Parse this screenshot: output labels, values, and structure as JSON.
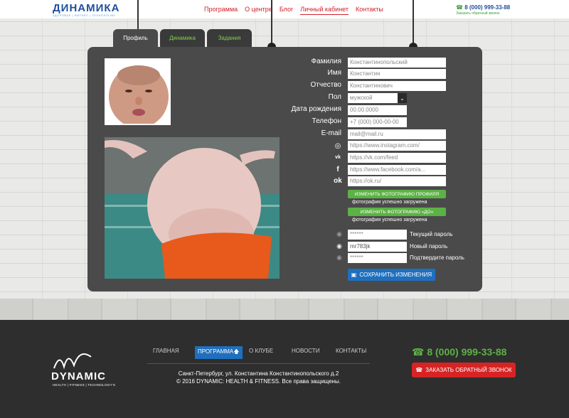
{
  "header": {
    "logo_text": "ДИНАМИКА",
    "logo_sub": "ЗДОРОВЬЕ | ФИТНЕС | ТЕХНОЛОГИИ",
    "nav": [
      "Программа",
      "О центре",
      "Блог",
      "Личный кабинет",
      "Контакты"
    ],
    "phone": "8 (000) 999-33-88",
    "callback": "Заказать обратный звонок"
  },
  "tabs": [
    "Профиль",
    "Динамика",
    "Задания"
  ],
  "profile": {
    "labels": {
      "surname": "Фамилия",
      "name": "Имя",
      "patronymic": "Отчество",
      "gender": "Пол",
      "birthdate": "Дата рождения",
      "phone": "Телефон",
      "email": "E-mail"
    },
    "values": {
      "surname": "Константинопольский",
      "name": "Константин",
      "patronymic": "Константинович",
      "gender": "мужской",
      "birthdate": "00.00.0000",
      "phone": "+7 (000) 000-00-00",
      "email": "mail@mail.ru"
    },
    "social": {
      "instagram": "https://www.instagram.com/",
      "vk": "https://vk.com/feed",
      "facebook": "https://www.facebook.com/a...",
      "ok": "https://ok.ru/"
    },
    "buttons": {
      "change_profile_photo": "ИЗМЕНИТЬ ФОТОГРАФИЮ ПРОФИЛЯ",
      "profile_photo_note": "фотография успешно загружена",
      "change_before_photo": "ИЗМЕНИТЬ ФОТОГРАФИЮ «ДО»",
      "before_photo_note": "фотография успешно загружена",
      "save": "СОХРАНИТЬ ИЗМЕНЕНИЯ"
    },
    "passwords": {
      "current_value": "******",
      "current_label": "Текущий пароль",
      "new_value": "mr783jk",
      "new_label": "Новый пароль",
      "confirm_value": "******",
      "confirm_label": "Подтвердите пароль"
    }
  },
  "footer": {
    "logo_text": "DYNAMIC",
    "logo_sub": "HEALTH | FITNESS | TECHNOLOGY'S",
    "nav": [
      "ГЛАВНАЯ",
      "ПРОГРАММА",
      "О КЛУБЕ",
      "НОВОСТИ",
      "КОНТАКТЫ"
    ],
    "address_line1": "Санкт-Петербург, ул. Константина Константинопольского д.2",
    "address_line2": "© 2016 DYNAMIC: HEALTH & FITNESS. Все права защищены.",
    "phone": "8 (000) 999-33-88",
    "callback": "ЗАКАЗАТЬ ОБРАТНЫЙ ЗВОНОК"
  },
  "colors": {
    "accent_red": "#d0202a",
    "accent_green": "#5cb245",
    "accent_blue": "#1f6fbf",
    "panel": "#4a4a4a",
    "footer": "#2e2e2e"
  }
}
